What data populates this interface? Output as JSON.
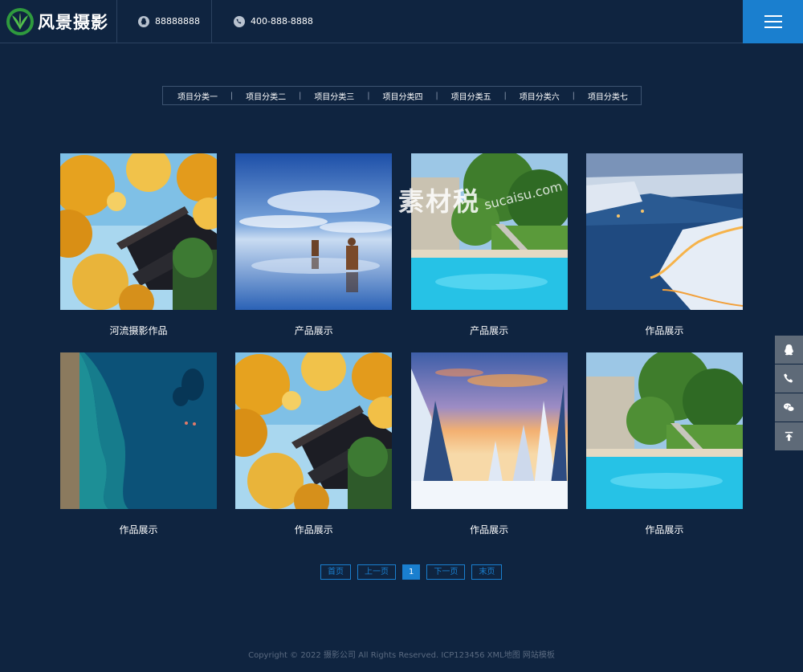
{
  "header": {
    "logo_text": "风景摄影",
    "qq": "88888888",
    "phone": "400-888-8888"
  },
  "categories": [
    "项目分类一",
    "项目分类二",
    "项目分类三",
    "项目分类四",
    "项目分类五",
    "项目分类六",
    "项目分类七"
  ],
  "items": [
    {
      "caption": "河流摄影作品",
      "image": "ginkgo-temple"
    },
    {
      "caption": "产品展示",
      "image": "horses-sky-reflection"
    },
    {
      "caption": "产品展示",
      "image": "pool-garden"
    },
    {
      "caption": "作品展示",
      "image": "snowy-coast-night"
    },
    {
      "caption": "作品展示",
      "image": "aerial-sea-rocks"
    },
    {
      "caption": "作品展示",
      "image": "ginkgo-temple"
    },
    {
      "caption": "作品展示",
      "image": "snowy-forest-sunset"
    },
    {
      "caption": "作品展示",
      "image": "pool-garden"
    }
  ],
  "pagination": {
    "first": "首页",
    "prev": "上一页",
    "current": "1",
    "next": "下一页",
    "last": "末页"
  },
  "footer": {
    "copyright": "Copyright © 2022 摄影公司 All Rights Reserved.",
    "icp": "ICP123456",
    "sitemap": "XML地图",
    "template": "网站模板"
  },
  "watermark": {
    "text1": "素材税",
    "text2": "sucaisu.com"
  },
  "colors": {
    "background": "#0f2440",
    "accent": "#1a7fcf",
    "side_button": "#5e6a78"
  }
}
